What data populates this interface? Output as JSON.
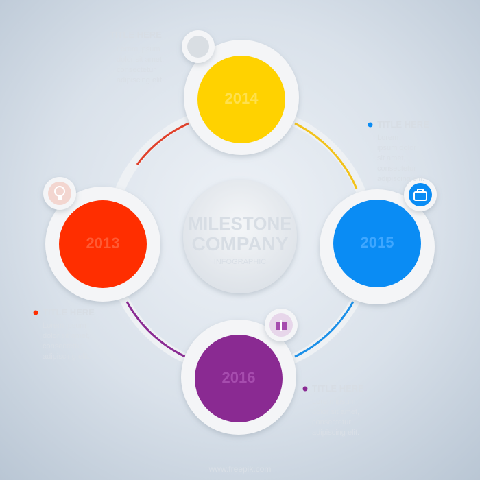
{
  "center": {
    "title_line1": "MILESTONE",
    "title_line2": "COMPANY",
    "subtitle": "INFOGRAPHIC"
  },
  "nodes": [
    {
      "id": "top",
      "color": "#ffd200",
      "label": "2014",
      "icon": "dot-icon"
    },
    {
      "id": "right",
      "color": "#0a8cf4",
      "label": "2015",
      "icon": "briefcase-icon"
    },
    {
      "id": "bottom",
      "color": "#8a2a92",
      "label": "2016",
      "icon": "gift-icon"
    },
    {
      "id": "left",
      "color": "#ff2e00",
      "label": "2013",
      "icon": "lightbulb-icon"
    }
  ],
  "notes": [
    {
      "id": "top-left",
      "title": "TITLE HERE",
      "lines": [
        "Lorem ipsum",
        "dolor sit amet,",
        "consectetur",
        "adipiscing elit."
      ]
    },
    {
      "id": "right",
      "title": "TITLE HERE",
      "lines": [
        "Lorem",
        "ipsum dolor",
        "sit amet,",
        "consectetur",
        "adipiscing elit."
      ]
    },
    {
      "id": "bottom-left",
      "title": "TITLE HERE",
      "lines": [
        "Lorem ipsum",
        "dolor sit amet,",
        "consectetur",
        "adipiscing elit."
      ]
    },
    {
      "id": "bottom-right",
      "title": "TITLE HERE",
      "lines": [
        "Lorem ipsum",
        "dolor sit amet,",
        "consectetur",
        "adipiscing elit."
      ]
    }
  ],
  "connector_colors": [
    "#e0402a",
    "#f2c21a",
    "#1a8fe8",
    "#8a2a92"
  ],
  "watermark": "www.freepik.com"
}
